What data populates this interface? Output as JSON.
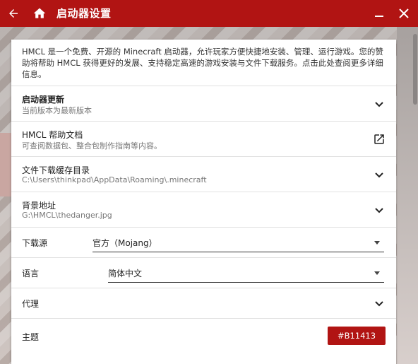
{
  "window": {
    "title": "启动器设置",
    "accent_color": "#B11413"
  },
  "about": {
    "text": "HMCL 是一个免费、开源的 Minecraft 启动器，允许玩家方便快捷地安装、管理、运行游戏。您的赞助将帮助 HMCL 获得更好的发展、支持稳定高速的游戏安装与文件下载服务。点击此处查阅更多详细信息。"
  },
  "rows": [
    {
      "title": "启动器更新",
      "subtitle": "当前版本为最新版本",
      "icon": "chevron-down-icon"
    },
    {
      "title": "HMCL 帮助文档",
      "subtitle": "可查阅数据包、整合包制作指南等内容。",
      "icon": "open-external-icon"
    },
    {
      "title": "文件下载缓存目录",
      "subtitle": "C:\\Users\\thinkpad\\AppData\\Roaming\\.minecraft",
      "icon": "chevron-down-icon"
    },
    {
      "title": "背景地址",
      "subtitle": "G:\\HMCL\\thedanger.jpg",
      "icon": "chevron-down-icon"
    }
  ],
  "download_source": {
    "label": "下载源",
    "value": "官方（Mojang）"
  },
  "language": {
    "label": "语言",
    "value": "简体中文"
  },
  "proxy": {
    "label": "代理",
    "icon": "chevron-down-icon"
  },
  "theme": {
    "label": "主题",
    "value": "#B11413"
  }
}
